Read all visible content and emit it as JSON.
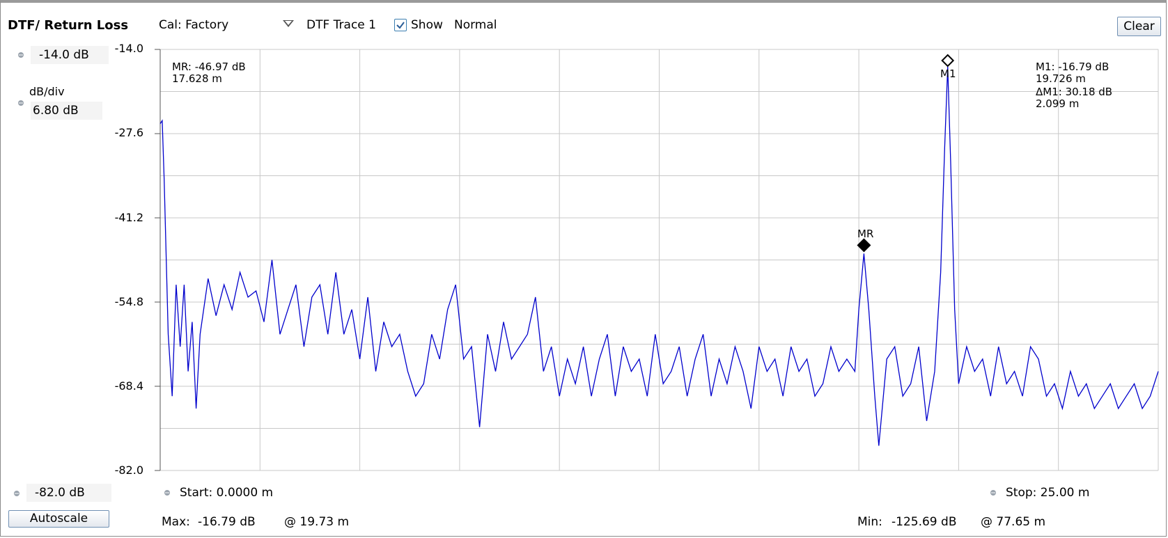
{
  "header": {
    "title": "DTF/ Return Loss",
    "cal_label": "Cal: Factory",
    "trace_label": "DTF Trace 1",
    "show_label": "Show",
    "show_checked": true,
    "mode_label": "Normal",
    "clear_label": "Clear"
  },
  "left_panel": {
    "top_value": "-14.0 dB",
    "dbdiv_label": "dB/div",
    "dbdiv_value": "6.80 dB",
    "bottom_value": "-82.0 dB",
    "autoscale_label": "Autoscale"
  },
  "footer": {
    "start": "Start: 0.0000 m",
    "stop": "Stop: 25.00 m",
    "max_label": "Max:",
    "max_value": "-16.79 dB",
    "max_at": "@ 19.73 m",
    "min_label": "Min:",
    "min_value": "-125.69 dB",
    "min_at": "@ 77.65 m"
  },
  "markers": {
    "mr_label": "MR",
    "mr_readout": [
      "MR: -46.97 dB",
      "17.628 m"
    ],
    "m1_label": "M1",
    "m1_readout": [
      "M1: -16.79 dB",
      "19.726 m",
      "ΔM1: 30.18 dB",
      "2.099 m"
    ]
  },
  "colors": {
    "trace": "#0000cc",
    "grid": "#c8c8c8",
    "axis": "#555555"
  },
  "chart_data": {
    "type": "line",
    "x_unit": "m",
    "y_unit": "dB",
    "xlim": [
      0,
      25
    ],
    "ylim": [
      -82.0,
      -14.0
    ],
    "y_ticks": [
      "-14.0",
      "-27.6",
      "-41.2",
      "-54.8",
      "-68.4",
      "-82.0"
    ],
    "x_divisions": 10,
    "grid": true,
    "series": [
      {
        "x": [
          0.0,
          0.05,
          0.1,
          0.2,
          0.3,
          0.4,
          0.5,
          0.6,
          0.7,
          0.8,
          0.9,
          1.0,
          1.2,
          1.4,
          1.6,
          1.8,
          2.0,
          2.2,
          2.4,
          2.6,
          2.8,
          3.0,
          3.2,
          3.4,
          3.6,
          3.8,
          4.0,
          4.2,
          4.4,
          4.6,
          4.8,
          5.0,
          5.2,
          5.4,
          5.6,
          5.8,
          6.0,
          6.2,
          6.4,
          6.6,
          6.8,
          7.0,
          7.2,
          7.4,
          7.6,
          7.8,
          8.0,
          8.2,
          8.4,
          8.6,
          8.8,
          9.0,
          9.2,
          9.4,
          9.6,
          9.8,
          10.0,
          10.2,
          10.4,
          10.6,
          10.8,
          11.0,
          11.2,
          11.4,
          11.6,
          11.8,
          12.0,
          12.2,
          12.4,
          12.6,
          12.8,
          13.0,
          13.2,
          13.4,
          13.6,
          13.8,
          14.0,
          14.2,
          14.4,
          14.6,
          14.8,
          15.0,
          15.2,
          15.4,
          15.6,
          15.8,
          16.0,
          16.2,
          16.4,
          16.6,
          16.8,
          17.0,
          17.2,
          17.4,
          17.5,
          17.628,
          17.75,
          17.9,
          18.0,
          18.2,
          18.4,
          18.6,
          18.8,
          19.0,
          19.2,
          19.4,
          19.55,
          19.65,
          19.726,
          19.8,
          19.9,
          20.0,
          20.2,
          20.4,
          20.6,
          20.8,
          21.0,
          21.2,
          21.4,
          21.6,
          21.8,
          22.0,
          22.2,
          22.4,
          22.6,
          22.8,
          23.0,
          23.2,
          23.4,
          23.6,
          23.8,
          24.0,
          24.2,
          24.4,
          24.6,
          24.8,
          25.0
        ],
        "y": [
          -26.0,
          -25.5,
          -35.0,
          -60.0,
          -70.0,
          -52.0,
          -62.0,
          -52.0,
          -66.0,
          -58.0,
          -72.0,
          -60.0,
          -51.0,
          -57.0,
          -52.0,
          -56.0,
          -50.0,
          -54.0,
          -53.0,
          -58.0,
          -48.0,
          -60.0,
          -56.0,
          -52.0,
          -62.0,
          -54.0,
          -52.0,
          -60.0,
          -50.0,
          -60.0,
          -56.0,
          -64.0,
          -54.0,
          -66.0,
          -58.0,
          -62.0,
          -60.0,
          -66.0,
          -70.0,
          -68.0,
          -60.0,
          -64.0,
          -56.0,
          -52.0,
          -64.0,
          -62.0,
          -75.0,
          -60.0,
          -66.0,
          -58.0,
          -64.0,
          -62.0,
          -60.0,
          -54.0,
          -66.0,
          -62.0,
          -70.0,
          -64.0,
          -68.0,
          -62.0,
          -70.0,
          -64.0,
          -60.0,
          -70.0,
          -62.0,
          -66.0,
          -64.0,
          -70.0,
          -60.0,
          -68.0,
          -66.0,
          -62.0,
          -70.0,
          -64.0,
          -60.0,
          -70.0,
          -64.0,
          -68.0,
          -62.0,
          -66.0,
          -72.0,
          -62.0,
          -66.0,
          -64.0,
          -70.0,
          -62.0,
          -66.0,
          -64.0,
          -70.0,
          -68.0,
          -62.0,
          -66.0,
          -64.0,
          -66.0,
          -56.0,
          -46.97,
          -56.0,
          -70.0,
          -78.0,
          -64.0,
          -62.0,
          -70.0,
          -68.0,
          -62.0,
          -74.0,
          -66.0,
          -50.0,
          -30.0,
          -16.79,
          -32.0,
          -56.0,
          -68.0,
          -62.0,
          -66.0,
          -64.0,
          -70.0,
          -62.0,
          -68.0,
          -66.0,
          -70.0,
          -62.0,
          -64.0,
          -70.0,
          -68.0,
          -72.0,
          -66.0,
          -70.0,
          -68.0,
          -72.0,
          -70.0,
          -68.0,
          -72.0,
          -70.0,
          -68.0,
          -72.0,
          -70.0,
          -66.0
        ]
      }
    ]
  }
}
